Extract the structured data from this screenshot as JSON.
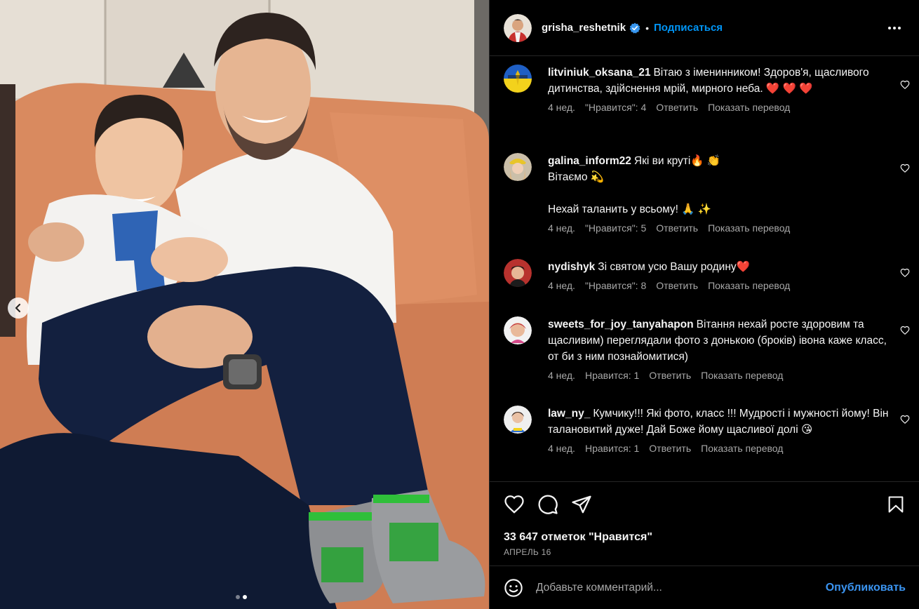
{
  "post": {
    "username": "grisha_reshetnik",
    "separator": "•",
    "follow_label": "Подписаться",
    "likes_text": "33 647 отметок \"Нравится\"",
    "date_text": "АПРЕЛЬ 16",
    "carousel": {
      "slides": 2,
      "active_index": 1
    }
  },
  "comments": [
    {
      "username": "litviniuk_oksana_21",
      "text": "Вітаю з іменинником! Здоров'я, щасливого дитинства, здійснення мрій, мирного неба. ❤️ ❤️ ❤️",
      "time": "4 нед.",
      "likes": "\"Нравится\": 4",
      "reply": "Ответить",
      "translate": "Показать перевод"
    },
    {
      "username": "galina_inform22",
      "text": "Які ви круті🔥 👏",
      "text2": "Вітаємо 💫",
      "text3": "Нехай таланить у всьому! 🙏 ✨",
      "time": "4 нед.",
      "likes": "\"Нравится\": 5",
      "reply": "Ответить",
      "translate": "Показать перевод"
    },
    {
      "username": "nydishyk",
      "text": "Зі святом усю Вашу родину❤️",
      "time": "4 нед.",
      "likes": "\"Нравится\": 8",
      "reply": "Ответить",
      "translate": "Показать перевод"
    },
    {
      "username": "sweets_for_joy_tanyahapon",
      "text": "Вітання нехай росте здоровим та щасливим) переглядали фото з донькою (броків) івона каже класс, от би з ним познайомитися)",
      "time": "4 нед.",
      "likes": "Нравится: 1",
      "reply": "Ответить",
      "translate": "Показать перевод"
    },
    {
      "username": "law_ny_",
      "text": "Кумчику!!! Які фото, класс !!! Мудрості і мужності йому! Він талановитий дуже! Дай Боже йому щасливої долі 😘",
      "time": "4 нед.",
      "likes": "Нравится: 1",
      "reply": "Ответить",
      "translate": "Показать перевод"
    }
  ],
  "add_comment": {
    "placeholder": "Добавьте комментарий...",
    "publish_label": "Опубликовать"
  },
  "icons": {
    "like": "heart-icon",
    "comment": "comment-bubble-icon",
    "share": "paper-plane-icon",
    "save": "bookmark-icon",
    "emoji": "smiley-icon",
    "more": "ellipsis-icon",
    "prev": "chevron-left-icon",
    "verified": "verified-badge-icon"
  },
  "colors": {
    "background": "#000000",
    "text": "#f5f5f5",
    "muted": "#a8a8a8",
    "accent": "#0095f6",
    "divider": "#262626"
  }
}
